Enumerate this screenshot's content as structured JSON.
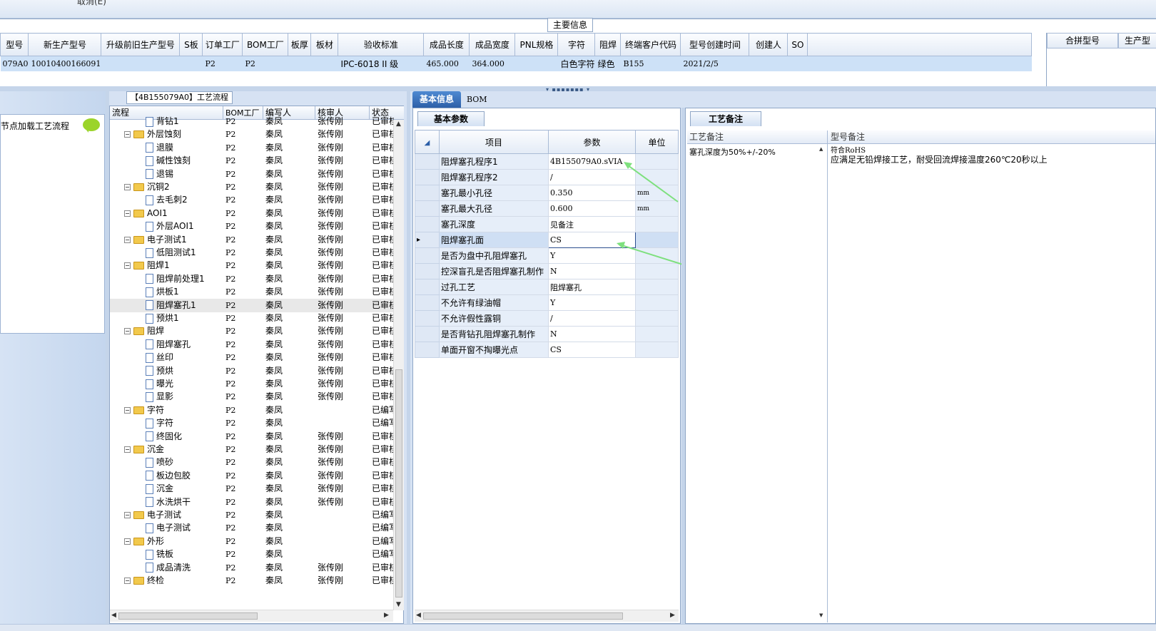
{
  "top": {
    "cut_label": "取消(E)",
    "main_info_label": "主要信息"
  },
  "header_grid": {
    "columns": [
      "型号",
      "新生产型号",
      "升级前旧生产型号",
      "S板",
      "订单工厂",
      "BOM工厂",
      "板厚",
      "板材",
      "验收标准",
      "成品长度",
      "成品宽度",
      "PNL规格",
      "字符",
      "阻焊",
      "终端客户代码",
      "型号创建时间",
      "创建人",
      "SO"
    ],
    "row": [
      "079A0",
      "10010400166091",
      "",
      "",
      "P2",
      "P2",
      "",
      "",
      "IPC-6018 II 级",
      "465.000",
      "364.000",
      "",
      "白色字符",
      "绿色",
      "B155",
      "2021/2/5",
      "",
      ""
    ]
  },
  "merge_panel": {
    "columns": [
      "合拼型号",
      "生产型"
    ]
  },
  "left_panel": {
    "label": "节点加载工艺流程"
  },
  "flow": {
    "title": "【4B155079A0】工艺流程",
    "columns": [
      "流程",
      "BOM工厂",
      "编写人",
      "核审人",
      "状态"
    ],
    "rows": [
      {
        "name": "背钻1",
        "level": 2,
        "type": "doc",
        "bom": "P2",
        "editor": "秦凤",
        "reviewer": "张传刚",
        "status": "已审核"
      },
      {
        "name": "外层蚀刻",
        "level": 1,
        "type": "folder",
        "bom": "P2",
        "editor": "秦凤",
        "reviewer": "张传刚",
        "status": "已审核"
      },
      {
        "name": "退膜",
        "level": 2,
        "type": "doc",
        "bom": "P2",
        "editor": "秦凤",
        "reviewer": "张传刚",
        "status": "已审核"
      },
      {
        "name": "碱性蚀刻",
        "level": 2,
        "type": "doc",
        "bom": "P2",
        "editor": "秦凤",
        "reviewer": "张传刚",
        "status": "已审核"
      },
      {
        "name": "退锡",
        "level": 2,
        "type": "doc",
        "bom": "P2",
        "editor": "秦凤",
        "reviewer": "张传刚",
        "status": "已审核"
      },
      {
        "name": "沉铜2",
        "level": 1,
        "type": "folder",
        "bom": "P2",
        "editor": "秦凤",
        "reviewer": "张传刚",
        "status": "已审核"
      },
      {
        "name": "去毛刺2",
        "level": 2,
        "type": "doc",
        "bom": "P2",
        "editor": "秦凤",
        "reviewer": "张传刚",
        "status": "已审核"
      },
      {
        "name": "AOI1",
        "level": 1,
        "type": "folder",
        "bom": "P2",
        "editor": "秦凤",
        "reviewer": "张传刚",
        "status": "已审核"
      },
      {
        "name": "外层AOI1",
        "level": 2,
        "type": "doc",
        "bom": "P2",
        "editor": "秦凤",
        "reviewer": "张传刚",
        "status": "已审核"
      },
      {
        "name": "电子测试1",
        "level": 1,
        "type": "folder",
        "bom": "P2",
        "editor": "秦凤",
        "reviewer": "张传刚",
        "status": "已审核"
      },
      {
        "name": "低阻测试1",
        "level": 2,
        "type": "doc",
        "bom": "P2",
        "editor": "秦凤",
        "reviewer": "张传刚",
        "status": "已审核"
      },
      {
        "name": "阻焊1",
        "level": 1,
        "type": "folder",
        "bom": "P2",
        "editor": "秦凤",
        "reviewer": "张传刚",
        "status": "已审核"
      },
      {
        "name": "阻焊前处理1",
        "level": 2,
        "type": "doc",
        "bom": "P2",
        "editor": "秦凤",
        "reviewer": "张传刚",
        "status": "已审核"
      },
      {
        "name": "烘板1",
        "level": 2,
        "type": "doc",
        "bom": "P2",
        "editor": "秦凤",
        "reviewer": "张传刚",
        "status": "已审核"
      },
      {
        "name": "阻焊塞孔1",
        "level": 2,
        "type": "doc",
        "bom": "P2",
        "editor": "秦凤",
        "reviewer": "张传刚",
        "status": "已审核",
        "selected": true
      },
      {
        "name": "预烘1",
        "level": 2,
        "type": "doc",
        "bom": "P2",
        "editor": "秦凤",
        "reviewer": "张传刚",
        "status": "已审核"
      },
      {
        "name": "阻焊",
        "level": 1,
        "type": "folder",
        "bom": "P2",
        "editor": "秦凤",
        "reviewer": "张传刚",
        "status": "已审核"
      },
      {
        "name": "阻焊塞孔",
        "level": 2,
        "type": "doc",
        "bom": "P2",
        "editor": "秦凤",
        "reviewer": "张传刚",
        "status": "已审核"
      },
      {
        "name": "丝印",
        "level": 2,
        "type": "doc",
        "bom": "P2",
        "editor": "秦凤",
        "reviewer": "张传刚",
        "status": "已审核"
      },
      {
        "name": "预烘",
        "level": 2,
        "type": "doc",
        "bom": "P2",
        "editor": "秦凤",
        "reviewer": "张传刚",
        "status": "已审核"
      },
      {
        "name": "曝光",
        "level": 2,
        "type": "doc",
        "bom": "P2",
        "editor": "秦凤",
        "reviewer": "张传刚",
        "status": "已审核"
      },
      {
        "name": "显影",
        "level": 2,
        "type": "doc",
        "bom": "P2",
        "editor": "秦凤",
        "reviewer": "张传刚",
        "status": "已审核"
      },
      {
        "name": "字符",
        "level": 1,
        "type": "folder",
        "bom": "P2",
        "editor": "秦凤",
        "reviewer": "",
        "status": "已编写"
      },
      {
        "name": "字符",
        "level": 2,
        "type": "doc",
        "bom": "P2",
        "editor": "秦凤",
        "reviewer": "",
        "status": "已编写"
      },
      {
        "name": "终固化",
        "level": 2,
        "type": "doc",
        "bom": "P2",
        "editor": "秦凤",
        "reviewer": "张传刚",
        "status": "已审核"
      },
      {
        "name": "沉金",
        "level": 1,
        "type": "folder",
        "bom": "P2",
        "editor": "秦凤",
        "reviewer": "张传刚",
        "status": "已审核"
      },
      {
        "name": "喷砂",
        "level": 2,
        "type": "doc",
        "bom": "P2",
        "editor": "秦凤",
        "reviewer": "张传刚",
        "status": "已审核"
      },
      {
        "name": "板边包胶",
        "level": 2,
        "type": "doc",
        "bom": "P2",
        "editor": "秦凤",
        "reviewer": "张传刚",
        "status": "已审核"
      },
      {
        "name": "沉金",
        "level": 2,
        "type": "doc",
        "bom": "P2",
        "editor": "秦凤",
        "reviewer": "张传刚",
        "status": "已审核"
      },
      {
        "name": "水洗烘干",
        "level": 2,
        "type": "doc",
        "bom": "P2",
        "editor": "秦凤",
        "reviewer": "张传刚",
        "status": "已审核"
      },
      {
        "name": "电子测试",
        "level": 1,
        "type": "folder",
        "bom": "P2",
        "editor": "秦凤",
        "reviewer": "",
        "status": "已编写"
      },
      {
        "name": "电子测试",
        "level": 2,
        "type": "doc",
        "bom": "P2",
        "editor": "秦凤",
        "reviewer": "",
        "status": "已编写"
      },
      {
        "name": "外形",
        "level": 1,
        "type": "folder",
        "bom": "P2",
        "editor": "秦凤",
        "reviewer": "",
        "status": "已编写"
      },
      {
        "name": "铣板",
        "level": 2,
        "type": "doc",
        "bom": "P2",
        "editor": "秦凤",
        "reviewer": "",
        "status": "已编写"
      },
      {
        "name": "成品清洗",
        "level": 2,
        "type": "doc",
        "bom": "P2",
        "editor": "秦凤",
        "reviewer": "张传刚",
        "status": "已审核"
      },
      {
        "name": "终检",
        "level": 1,
        "type": "folder",
        "bom": "P2",
        "editor": "秦凤",
        "reviewer": "张传刚",
        "status": "已审核"
      }
    ]
  },
  "basic": {
    "tabs": [
      "基本信息",
      "BOM"
    ],
    "subtab": "基本参数",
    "columns": [
      "项目",
      "参数",
      "单位"
    ],
    "rows": [
      {
        "item": "阻焊塞孔程序1",
        "value": "4B155079A0.sVIA",
        "unit": ""
      },
      {
        "item": "阻焊塞孔程序2",
        "value": "/",
        "unit": ""
      },
      {
        "item": "塞孔最小孔径",
        "value": "0.350",
        "unit": "mm"
      },
      {
        "item": "塞孔最大孔径",
        "value": "0.600",
        "unit": "mm"
      },
      {
        "item": "塞孔深度",
        "value": "见备注",
        "unit": ""
      },
      {
        "item": "阻焊塞孔面",
        "value": "CS",
        "unit": "",
        "selected": true
      },
      {
        "item": "是否为盘中孔阻焊塞孔",
        "value": "Y",
        "unit": ""
      },
      {
        "item": "控深盲孔是否阻焊塞孔制作",
        "value": "N",
        "unit": ""
      },
      {
        "item": "过孔工艺",
        "value": "阻焊塞孔",
        "unit": ""
      },
      {
        "item": "不允许有绿油帽",
        "value": "Y",
        "unit": ""
      },
      {
        "item": "不允许假性露铜",
        "value": "/",
        "unit": ""
      },
      {
        "item": "是否背钻孔阻焊塞孔制作",
        "value": "N",
        "unit": ""
      },
      {
        "item": "单面开窗不掏曝光点",
        "value": "CS",
        "unit": ""
      }
    ]
  },
  "notes": {
    "subtab": "工艺备注",
    "columns": [
      "工艺备注",
      "型号备注"
    ],
    "process_note": "塞孔深度为50%+/-20%",
    "model_note_line1": "符合RoHS",
    "model_note_line2": "应满足无铅焊接工艺，耐受回流焊接温度260℃20秒以上"
  },
  "colors": {
    "arrow": "#7ee07e",
    "selection": "#cde1f7",
    "tab_active": "#2c5fa8"
  }
}
